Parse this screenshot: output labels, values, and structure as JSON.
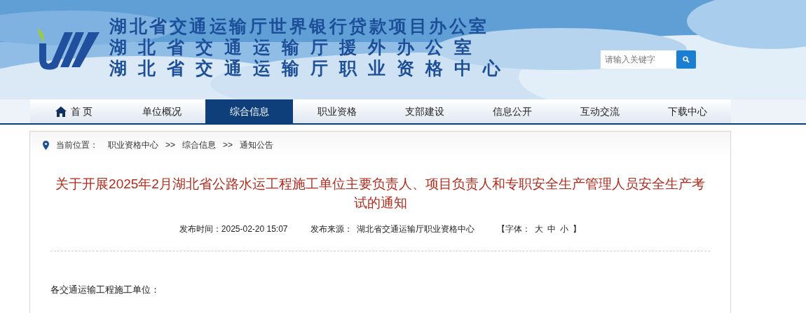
{
  "header": {
    "titles": [
      "湖北省交通运输厅世界银行贷款项目办公室",
      "湖北省交通运输厅援外办公室",
      "湖北省交通运输厅职业资格中心"
    ],
    "search": {
      "placeholder": "请输入关键字"
    }
  },
  "nav": [
    {
      "label": "首 页",
      "selected": false,
      "kind": "home"
    },
    {
      "label": "单位概况",
      "selected": false,
      "kind": "link"
    },
    {
      "label": "综合信息",
      "selected": true,
      "kind": "link"
    },
    {
      "label": "职业资格",
      "selected": false,
      "kind": "link"
    },
    {
      "label": "支部建设",
      "selected": false,
      "kind": "link"
    },
    {
      "label": "信息公开",
      "selected": false,
      "kind": "link"
    },
    {
      "label": "互动交流",
      "selected": false,
      "kind": "link"
    },
    {
      "label": "下载中心",
      "selected": false,
      "kind": "link"
    }
  ],
  "breadcrumb": {
    "label": "当前位置：",
    "items": [
      "职业资格中心",
      "综合信息",
      "通知公告"
    ],
    "separator": ">>"
  },
  "article": {
    "title": "关于开展2025年2月湖北省公路水运工程施工单位主要负责人、项目负责人和专职安全生产管理人员安全生产考试的通知",
    "date": "发布时间：2025-02-20 15:07",
    "source": "发布来源：  湖北省交通运输厅职业资格中心",
    "font_size": {
      "open": "【字体：",
      "sizes": [
        "大",
        "中",
        "小"
      ],
      "close": "】"
    },
    "body": [
      "各交通运输工程施工单位："
    ]
  }
}
